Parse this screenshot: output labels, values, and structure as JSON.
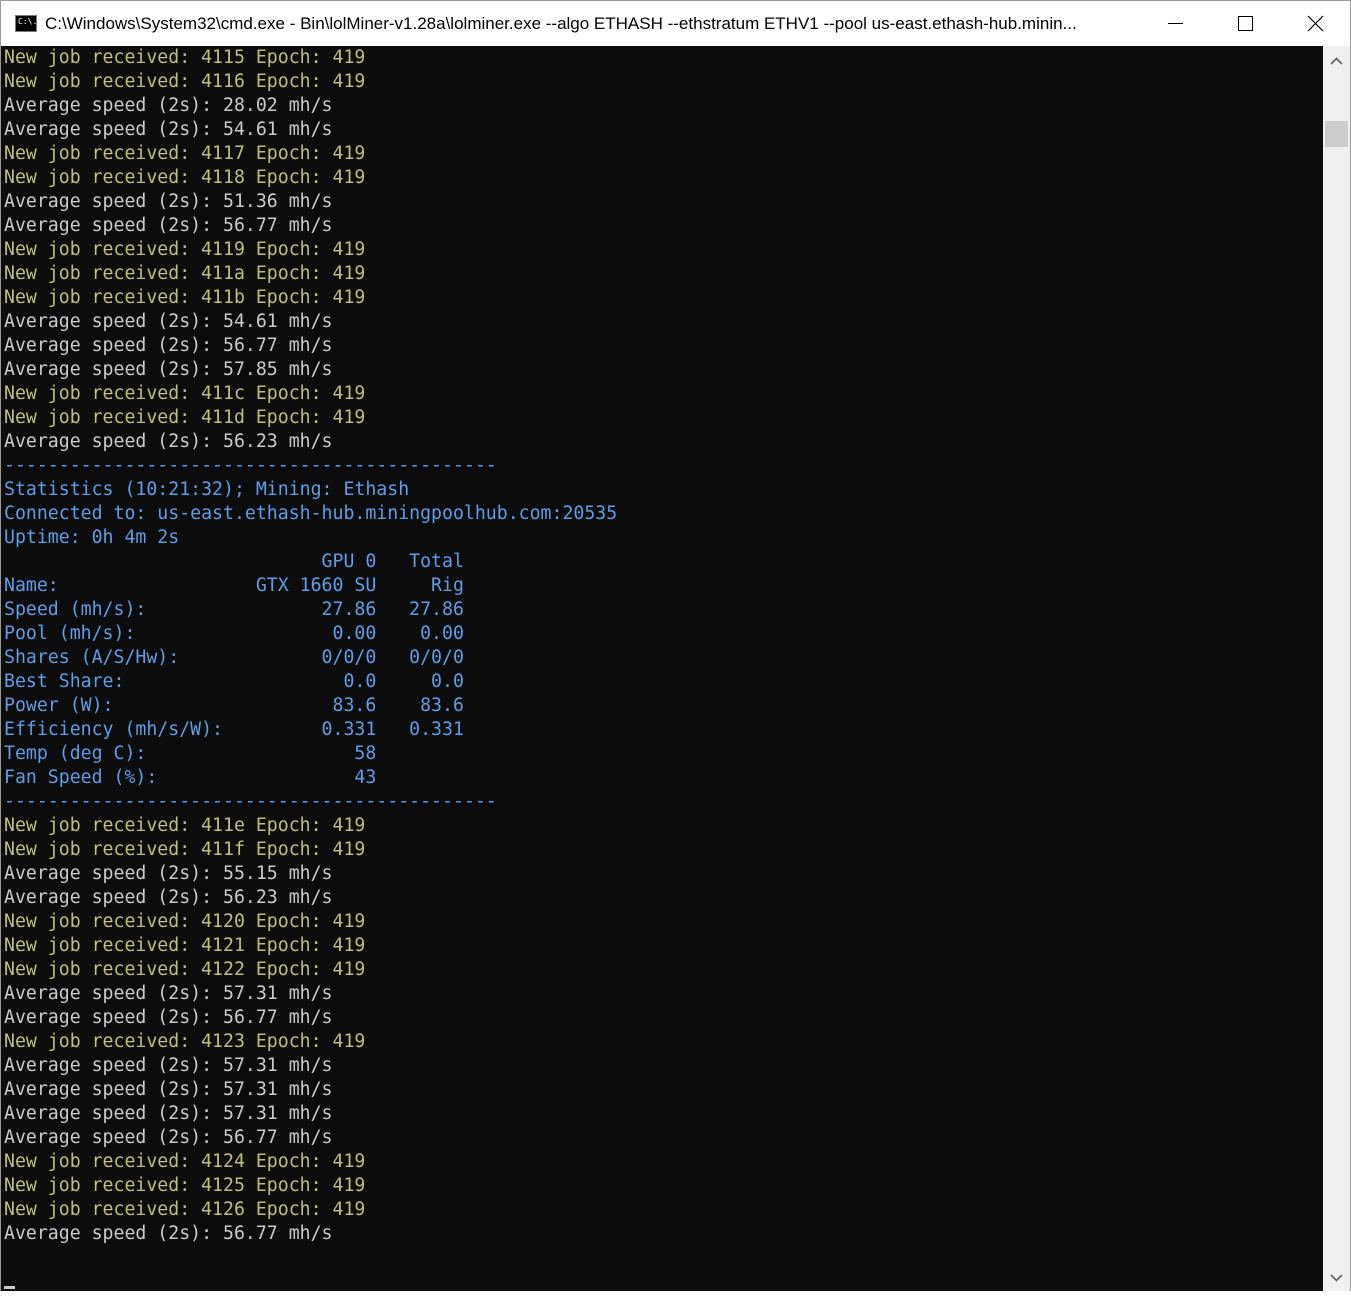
{
  "window": {
    "title": "C:\\Windows\\System32\\cmd.exe - Bin\\lolMiner-v1.28a\\lolminer.exe  --algo ETHASH --ethstratum ETHV1 --pool us-east.ethash-hub.minin...",
    "icon_label": "C:\\."
  },
  "colors": {
    "job": "#c1c078",
    "speed": "#cccccc",
    "stat": "#5f9eeb",
    "background": "#0c0c0c"
  },
  "console": {
    "lines": [
      {
        "type": "job",
        "text": "New job received: 4115 Epoch: 419"
      },
      {
        "type": "job",
        "text": "New job received: 4116 Epoch: 419"
      },
      {
        "type": "speed",
        "text": "Average speed (2s): 28.02 mh/s"
      },
      {
        "type": "speed",
        "text": "Average speed (2s): 54.61 mh/s"
      },
      {
        "type": "job",
        "text": "New job received: 4117 Epoch: 419"
      },
      {
        "type": "job",
        "text": "New job received: 4118 Epoch: 419"
      },
      {
        "type": "speed",
        "text": "Average speed (2s): 51.36 mh/s"
      },
      {
        "type": "speed",
        "text": "Average speed (2s): 56.77 mh/s"
      },
      {
        "type": "job",
        "text": "New job received: 4119 Epoch: 419"
      },
      {
        "type": "job",
        "text": "New job received: 411a Epoch: 419"
      },
      {
        "type": "job",
        "text": "New job received: 411b Epoch: 419"
      },
      {
        "type": "speed",
        "text": "Average speed (2s): 54.61 mh/s"
      },
      {
        "type": "speed",
        "text": "Average speed (2s): 56.77 mh/s"
      },
      {
        "type": "speed",
        "text": "Average speed (2s): 57.85 mh/s"
      },
      {
        "type": "job",
        "text": "New job received: 411c Epoch: 419"
      },
      {
        "type": "job",
        "text": "New job received: 411d Epoch: 419"
      },
      {
        "type": "speed",
        "text": "Average speed (2s): 56.23 mh/s"
      },
      {
        "type": "stat",
        "text": "---------------------------------------------"
      },
      {
        "type": "stat",
        "text": "Statistics (10:21:32); Mining: Ethash"
      },
      {
        "type": "stat",
        "text": "Connected to: us-east.ethash-hub.miningpoolhub.com:20535"
      },
      {
        "type": "stat",
        "text": "Uptime: 0h 4m 2s"
      },
      {
        "type": "stat",
        "text": "                             GPU 0   Total"
      },
      {
        "type": "stat",
        "text": "Name:                  GTX 1660 SU     Rig"
      },
      {
        "type": "stat",
        "text": "Speed (mh/s):                27.86   27.86"
      },
      {
        "type": "stat",
        "text": "Pool (mh/s):                  0.00    0.00"
      },
      {
        "type": "stat",
        "text": "Shares (A/S/Hw):             0/0/0   0/0/0"
      },
      {
        "type": "stat",
        "text": "Best Share:                    0.0     0.0"
      },
      {
        "type": "stat",
        "text": "Power (W):                    83.6    83.6"
      },
      {
        "type": "stat",
        "text": "Efficiency (mh/s/W):         0.331   0.331"
      },
      {
        "type": "stat",
        "text": "Temp (deg C):                   58"
      },
      {
        "type": "stat",
        "text": "Fan Speed (%):                  43"
      },
      {
        "type": "stat",
        "text": "---------------------------------------------"
      },
      {
        "type": "job",
        "text": "New job received: 411e Epoch: 419"
      },
      {
        "type": "job",
        "text": "New job received: 411f Epoch: 419"
      },
      {
        "type": "speed",
        "text": "Average speed (2s): 55.15 mh/s"
      },
      {
        "type": "speed",
        "text": "Average speed (2s): 56.23 mh/s"
      },
      {
        "type": "job",
        "text": "New job received: 4120 Epoch: 419"
      },
      {
        "type": "job",
        "text": "New job received: 4121 Epoch: 419"
      },
      {
        "type": "job",
        "text": "New job received: 4122 Epoch: 419"
      },
      {
        "type": "speed",
        "text": "Average speed (2s): 57.31 mh/s"
      },
      {
        "type": "speed",
        "text": "Average speed (2s): 56.77 mh/s"
      },
      {
        "type": "job",
        "text": "New job received: 4123 Epoch: 419"
      },
      {
        "type": "speed",
        "text": "Average speed (2s): 57.31 mh/s"
      },
      {
        "type": "speed",
        "text": "Average speed (2s): 57.31 mh/s"
      },
      {
        "type": "speed",
        "text": "Average speed (2s): 57.31 mh/s"
      },
      {
        "type": "speed",
        "text": "Average speed (2s): 56.77 mh/s"
      },
      {
        "type": "job",
        "text": "New job received: 4124 Epoch: 419"
      },
      {
        "type": "job",
        "text": "New job received: 4125 Epoch: 419"
      },
      {
        "type": "job",
        "text": "New job received: 4126 Epoch: 419"
      },
      {
        "type": "speed",
        "text": "Average speed (2s): 56.77 mh/s"
      }
    ]
  },
  "icons": {
    "minimize": "minimize-icon",
    "maximize": "maximize-icon",
    "close": "close-icon",
    "scroll_up": "chevron-up-icon",
    "scroll_down": "chevron-down-icon"
  }
}
